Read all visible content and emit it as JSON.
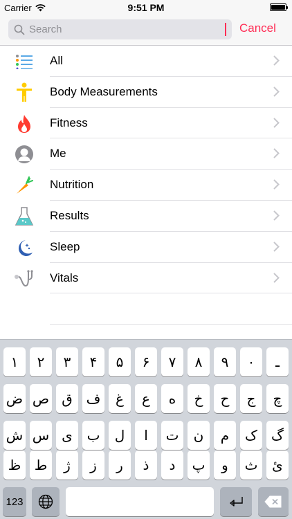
{
  "status_bar": {
    "carrier": "Carrier",
    "time": "9:51 PM",
    "battery_level": 1.0
  },
  "search": {
    "placeholder": "Search",
    "value": "",
    "cancel_label": "Cancel"
  },
  "categories": [
    {
      "label": "All",
      "icon": "all-list-icon"
    },
    {
      "label": "Body Measurements",
      "icon": "body-figure-icon"
    },
    {
      "label": "Fitness",
      "icon": "flame-icon"
    },
    {
      "label": "Me",
      "icon": "person-icon"
    },
    {
      "label": "Nutrition",
      "icon": "carrot-icon"
    },
    {
      "label": "Results",
      "icon": "flask-icon"
    },
    {
      "label": "Sleep",
      "icon": "moon-icon"
    },
    {
      "label": "Vitals",
      "icon": "stethoscope-icon"
    }
  ],
  "keyboard": {
    "rows": [
      [
        "۱",
        "۲",
        "۳",
        "۴",
        "۵",
        "۶",
        "۷",
        "۸",
        "۹",
        "۰",
        "ـ"
      ],
      [
        "ض",
        "ص",
        "ق",
        "ف",
        "غ",
        "ع",
        "ه",
        "خ",
        "ح",
        "ج",
        "چ"
      ],
      [
        "ش",
        "س",
        "ی",
        "ب",
        "ل",
        "ا",
        "ت",
        "ن",
        "م",
        "ک",
        "گ"
      ],
      [
        "ظ",
        "ط",
        "ژ",
        "ز",
        "ر",
        "ذ",
        "د",
        "پ",
        "و",
        "ث",
        "ئ"
      ]
    ],
    "numbers_key": "123",
    "globe_icon": "globe-icon",
    "return_icon": "return-icon",
    "backspace_icon": "backspace-icon"
  },
  "colors": {
    "accent": "#ff2d55",
    "keyboard_bg": "#d1d5db",
    "fn_key": "#adb3bc",
    "separator": "#e0e0e4"
  }
}
